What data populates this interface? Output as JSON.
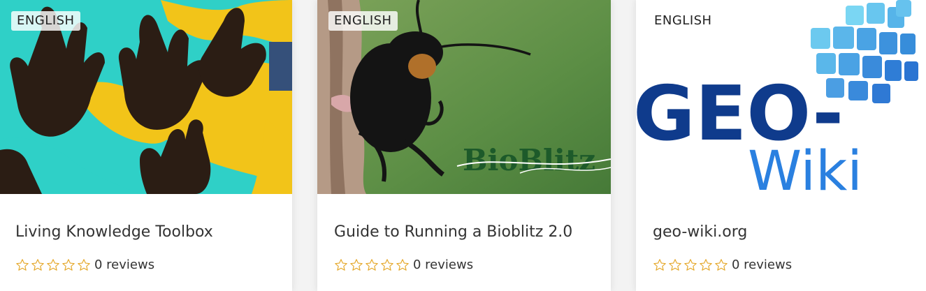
{
  "colors": {
    "star": "#e5a82a",
    "page_bg": "#f3f3f3",
    "geo_blue": "#0f3b8c",
    "wiki_blue": "#2a80e0"
  },
  "cards": [
    {
      "language": "ENGLISH",
      "title": "Living Knowledge Toolbox",
      "rating": 0,
      "reviews": "0 reviews",
      "image": "hands-on-world-map-image"
    },
    {
      "language": "ENGLISH",
      "title": "Guide to Running a Bioblitz 2.0",
      "rating": 0,
      "reviews": "0 reviews",
      "image": "beetle-bioblitz-image",
      "image_text": "BioBlitz"
    },
    {
      "language": "ENGLISH",
      "title": "geo-wiki.org",
      "rating": 0,
      "reviews": "0 reviews",
      "image": "geo-wiki-logo-image",
      "logo_text_1": "GEO-",
      "logo_text_2": "Wiki"
    }
  ]
}
